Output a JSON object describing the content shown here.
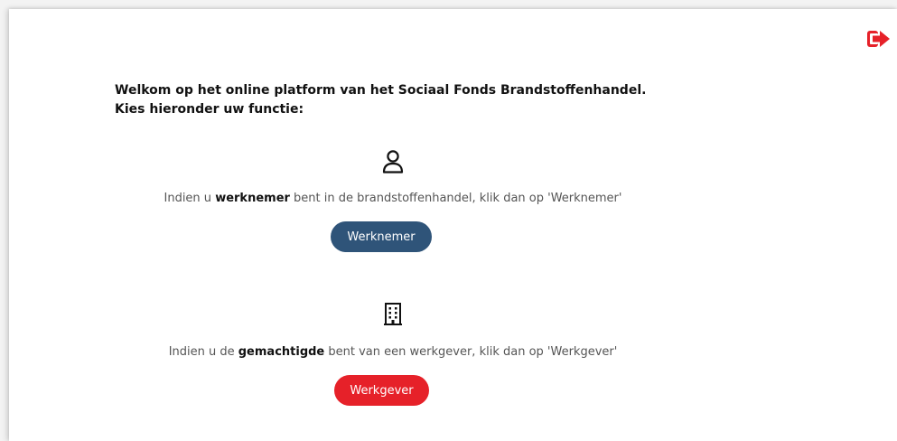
{
  "header": {
    "logout_icon": "logout-arrow-icon",
    "logout_color": "#e62129"
  },
  "welcome": {
    "line1": "Welkom op het online platform van het Sociaal Fonds Brandstoffenhandel.",
    "line2": "Kies hieronder uw functie:"
  },
  "werknemer": {
    "icon": "user-icon",
    "text_before": "Indien u ",
    "text_bold": "werknemer",
    "text_after": " bent in de brandstoffenhandel, klik dan op 'Werknemer'",
    "button_label": "Werknemer",
    "button_color": "#2f5479"
  },
  "werkgever": {
    "icon": "building-icon",
    "text_before": "Indien u de ",
    "text_bold": "gemachtigde",
    "text_after": " bent van een werkgever, klik dan op 'Werkgever'",
    "button_label": "Werkgever",
    "button_color": "#e62129"
  }
}
